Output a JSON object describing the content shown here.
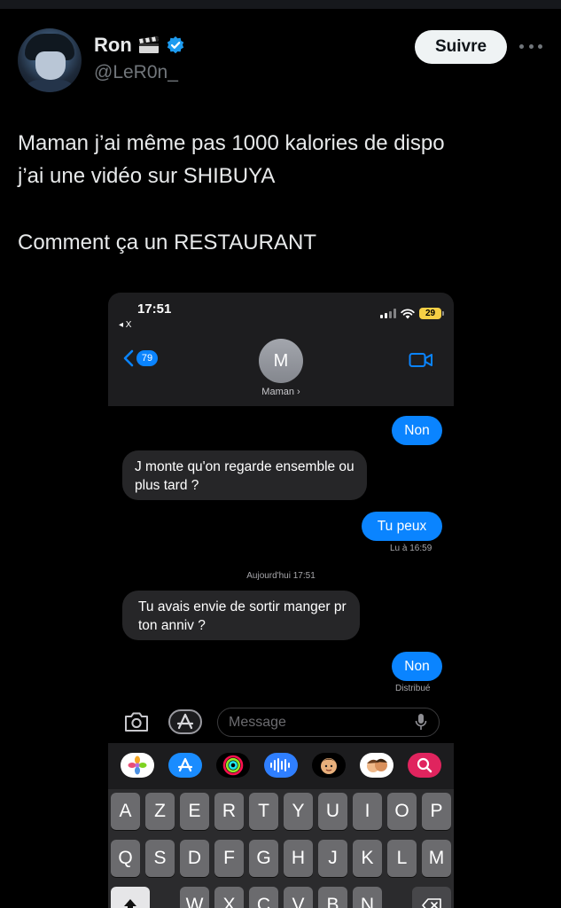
{
  "tweet": {
    "author_name": "Ron",
    "author_handle": "@LeR0n_",
    "follow_label": "Suivre",
    "lines": [
      "Maman j’ai même pas 1000 kalories de dispo",
      "j’ai une vidéo sur SHIBUYA",
      "Comment ça un RESTAURANT"
    ]
  },
  "phone": {
    "status_time": "17:51",
    "status_back": "◂ X",
    "battery": "29",
    "back_badge": "79",
    "contact_initial": "M",
    "contact_name": "Maman ›",
    "messages": [
      {
        "from": "me",
        "text": "Non"
      },
      {
        "from": "them",
        "text": "J monte qu'on regarde ensemble ou plus tard ?"
      },
      {
        "from": "me",
        "text": "Tu peux"
      },
      {
        "from": "them",
        "text": "Tu avais envie de sortir manger pr ton anniv ?"
      },
      {
        "from": "me",
        "text": "Non"
      }
    ],
    "read_receipt": "Lu à 16:59",
    "date_separator": "Aujourd'hui 17:51",
    "delivered": "Distribué",
    "input_placeholder": "Message",
    "keyboard_row1": [
      "A",
      "Z",
      "E",
      "R",
      "T",
      "Y",
      "U",
      "I",
      "O",
      "P"
    ],
    "keyboard_row2": [
      "Q",
      "S",
      "D",
      "F",
      "G",
      "H",
      "J",
      "K",
      "L",
      "M"
    ],
    "keyboard_row3": [
      "W",
      "X",
      "C",
      "V",
      "B",
      "N"
    ]
  },
  "colors": {
    "accent": "#0a84ff",
    "verified": "#1d9bf0",
    "battery": "#f6cf45"
  }
}
